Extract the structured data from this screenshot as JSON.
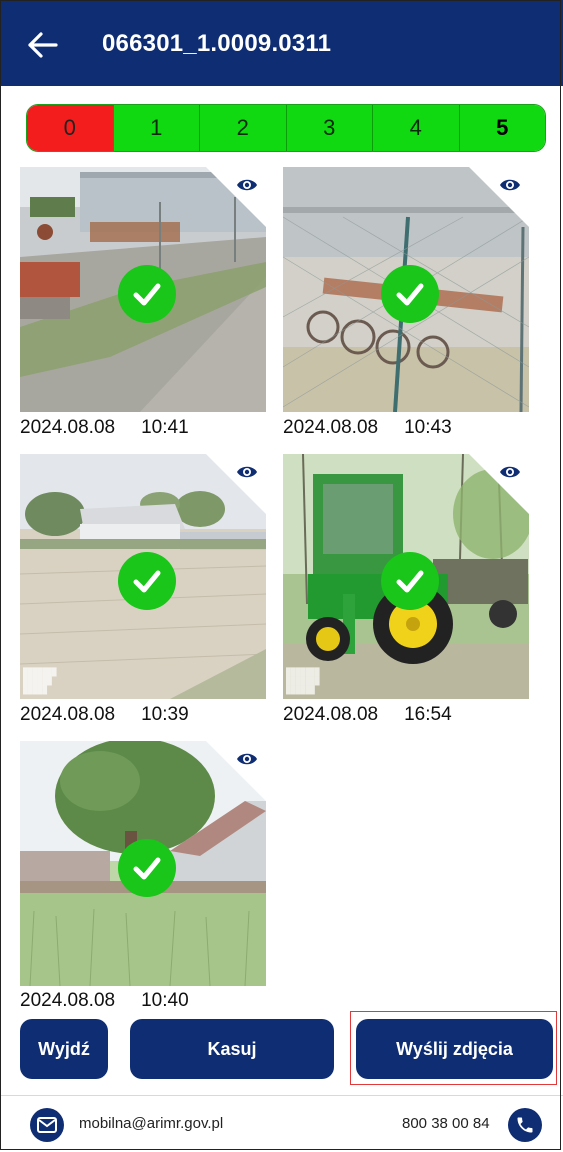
{
  "header": {
    "title": "066301_1.0009.0311"
  },
  "segments": [
    {
      "label": "0"
    },
    {
      "label": "1"
    },
    {
      "label": "2"
    },
    {
      "label": "3"
    },
    {
      "label": "4"
    },
    {
      "label": "5"
    }
  ],
  "photos": [
    {
      "date": "2024.08.08",
      "time": "10:41"
    },
    {
      "date": "2024.08.08",
      "time": "10:43"
    },
    {
      "date": "2024.08.08",
      "time": "10:39"
    },
    {
      "date": "2024.08.08",
      "time": "16:54"
    },
    {
      "date": "2024.08.08",
      "time": "10:40"
    }
  ],
  "buttons": {
    "exit": "Wyjdź",
    "delete": "Kasuj",
    "send": "Wyślij zdjęcia"
  },
  "footer": {
    "email": "mobilna@arimr.gov.pl",
    "phone": "800 38 00 84"
  },
  "colors": {
    "primary": "#0f2d73",
    "segment_green": "#11d911",
    "segment_red": "#f31d1d",
    "check_green": "#19c619"
  },
  "icons": [
    "back-arrow-icon",
    "eye-icon",
    "checkmark-icon",
    "email-icon",
    "phone-icon"
  ]
}
